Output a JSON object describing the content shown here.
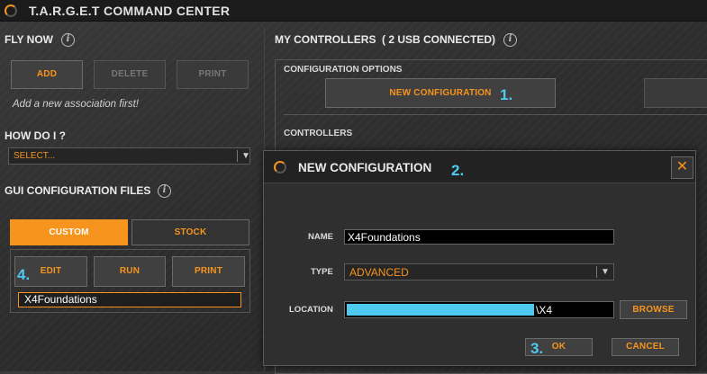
{
  "window": {
    "title": "T.A.R.G.E.T COMMAND CENTER"
  },
  "fly_now": {
    "title": "FLY NOW",
    "add_label": "ADD",
    "delete_label": "DELETE",
    "print_label": "PRINT",
    "hint": "Add a new association first!"
  },
  "how_do_i": {
    "title": "HOW DO I ?",
    "selected": "SELECT..."
  },
  "gui_config": {
    "title": "GUI CONFIGURATION FILES",
    "tab_custom": "CUSTOM",
    "tab_stock": "STOCK",
    "edit_label": "EDIT",
    "run_label": "RUN",
    "print_label": "PRINT",
    "file_item": "X4Foundations"
  },
  "controllers": {
    "title": "MY CONTROLLERS",
    "count": "( 2 USB CONNECTED)",
    "config_options": "CONFIGURATION OPTIONS",
    "new_config_label": "NEW CONFIGURATION",
    "controllers_label": "CONTROLLERS"
  },
  "dialog": {
    "title": "NEW CONFIGURATION",
    "name_label": "NAME",
    "name_value": "X4Foundations",
    "type_label": "TYPE",
    "type_value": "ADVANCED",
    "location_label": "LOCATION",
    "location_value": "\\X4",
    "browse_label": "BROWSE",
    "ok_label": "OK",
    "cancel_label": "CANCEL"
  },
  "steps": {
    "s1": "1.",
    "s2": "2.",
    "s3": "3.",
    "s4": "4."
  },
  "icons": {
    "info": "i",
    "close": "✕",
    "dropdown": "▼"
  },
  "colors": {
    "accent": "#f7941d",
    "annotation": "#4ec9f0"
  }
}
